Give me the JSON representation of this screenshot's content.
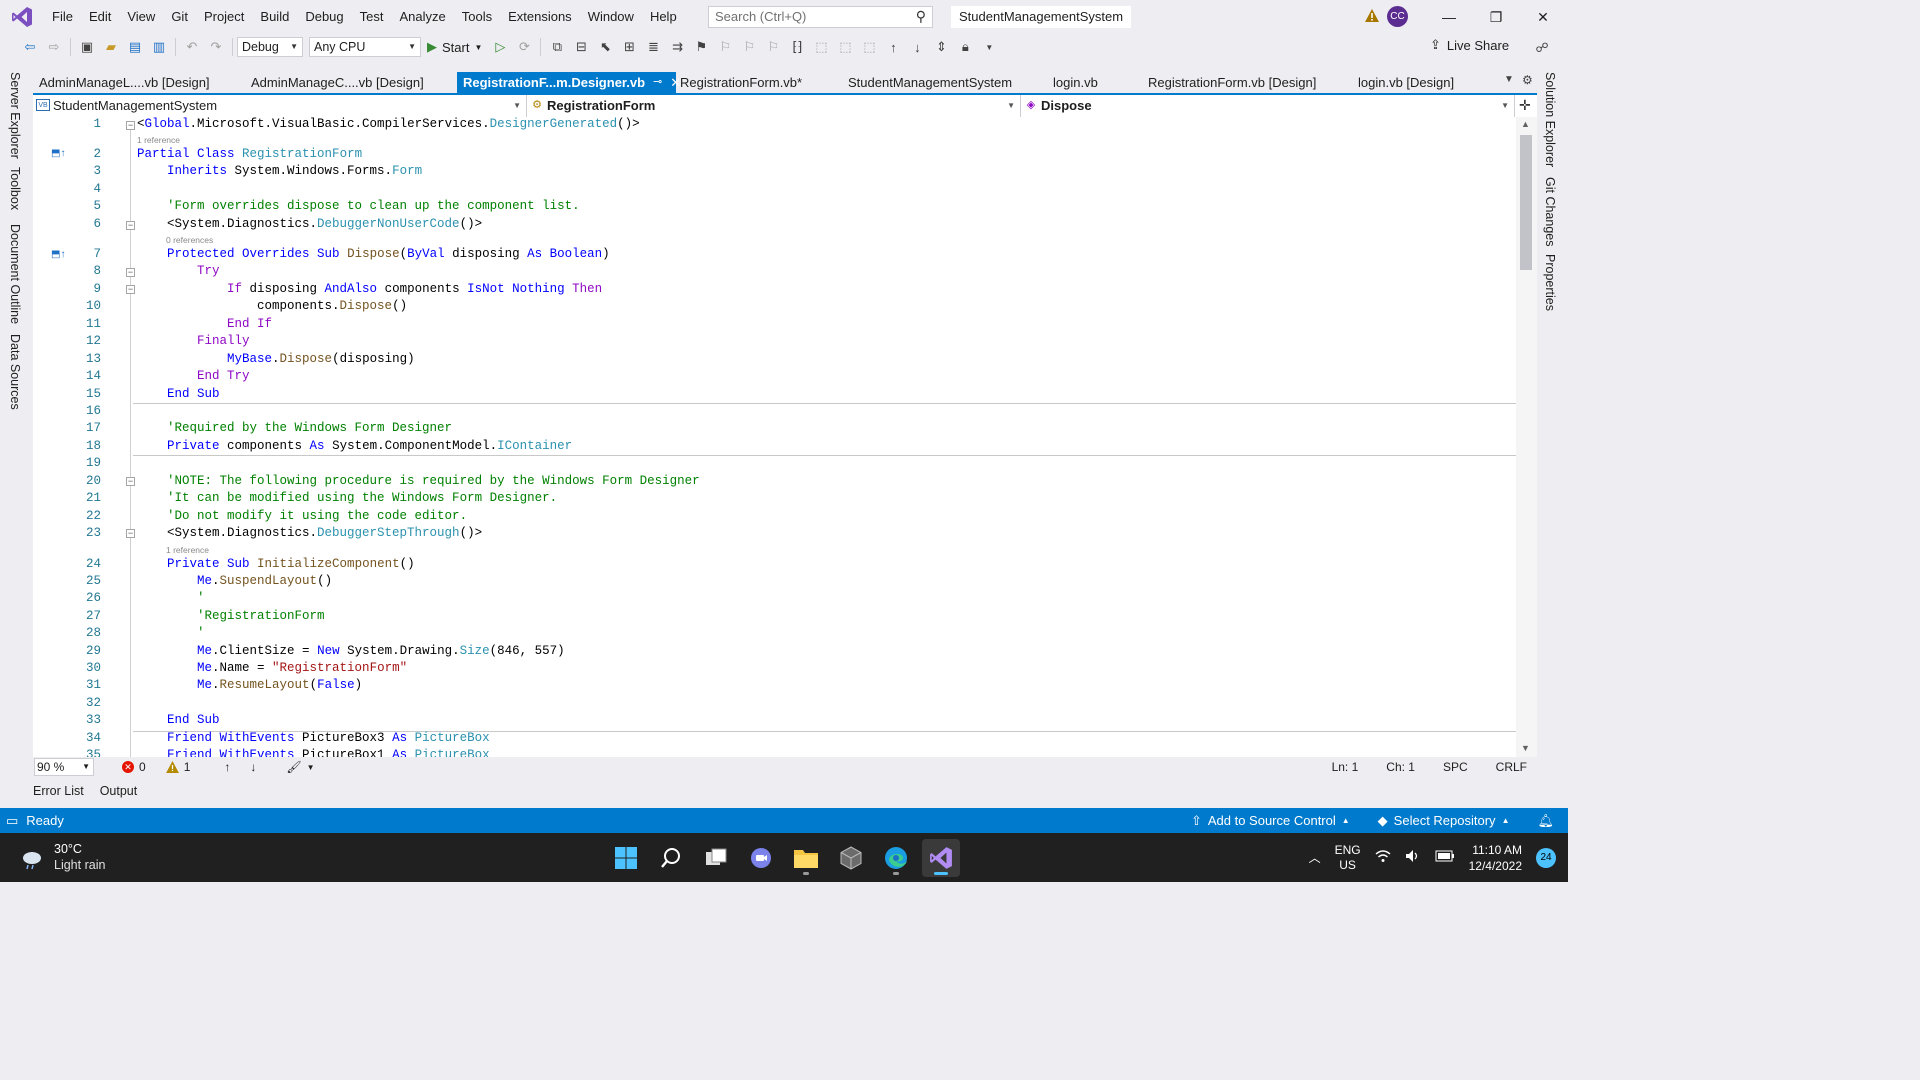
{
  "menubar": {
    "items": [
      "File",
      "Edit",
      "View",
      "Git",
      "Project",
      "Build",
      "Debug",
      "Test",
      "Analyze",
      "Tools",
      "Extensions",
      "Window",
      "Help"
    ],
    "search_placeholder": "Search (Ctrl+Q)",
    "solution_name": "StudentManagementSystem",
    "avatar_initials": "CC"
  },
  "toolbar": {
    "config": "Debug",
    "platform": "Any CPU",
    "start_label": "Start",
    "live_share_label": "Live Share"
  },
  "side_tabs": {
    "left": [
      "Server Explorer",
      "Toolbox",
      "Document Outline",
      "Data Sources"
    ],
    "right": [
      "Solution Explorer",
      "Git Changes",
      "Properties"
    ]
  },
  "doc_tabs": [
    {
      "label": "AdminManageL....vb [Design]",
      "active": false
    },
    {
      "label": "AdminManageC....vb [Design]",
      "active": false
    },
    {
      "label": "RegistrationF...m.Designer.vb",
      "active": true
    },
    {
      "label": "RegistrationForm.vb*",
      "active": false
    },
    {
      "label": "StudentManagementSystem",
      "active": false
    },
    {
      "label": "login.vb",
      "active": false
    },
    {
      "label": "RegistrationForm.vb [Design]",
      "active": false
    },
    {
      "label": "login.vb [Design]",
      "active": false
    }
  ],
  "navbar": {
    "project": "StudentManagementSystem",
    "class": "RegistrationForm",
    "member": "Dispose"
  },
  "codelens": {
    "l1": "1 reference",
    "l6": "0 references",
    "l23": "1 reference"
  },
  "code": {
    "line_numbers": [
      "1",
      "2",
      "3",
      "4",
      "5",
      "6",
      "7",
      "8",
      "9",
      "10",
      "11",
      "12",
      "13",
      "14",
      "15",
      "16",
      "17",
      "18",
      "19",
      "20",
      "21",
      "22",
      "23",
      "24",
      "25",
      "26",
      "27",
      "28",
      "29",
      "30",
      "31",
      "32",
      "33",
      "34",
      "35"
    ]
  },
  "editor_status": {
    "zoom": "90 %",
    "errors": "0",
    "warnings": "1",
    "ln": "Ln: 1",
    "ch": "Ch: 1",
    "spc": "SPC",
    "eol": "CRLF"
  },
  "bottom_tabs": [
    "Error List",
    "Output"
  ],
  "statusbar": {
    "ready": "Ready",
    "source_control": "Add to Source Control",
    "repository": "Select Repository"
  },
  "taskbar": {
    "temperature": "30°C",
    "weather": "Light rain",
    "lang_top": "ENG",
    "lang_bottom": "US",
    "time": "11:10 AM",
    "date": "12/4/2022",
    "notifications": "24"
  },
  "colors": {
    "accent": "#007acc",
    "keyword": "#0000ff",
    "control_keyword": "#8f08c4",
    "type": "#2b91af",
    "comment": "#008000",
    "string": "#a31515",
    "line_number": "#237893"
  }
}
